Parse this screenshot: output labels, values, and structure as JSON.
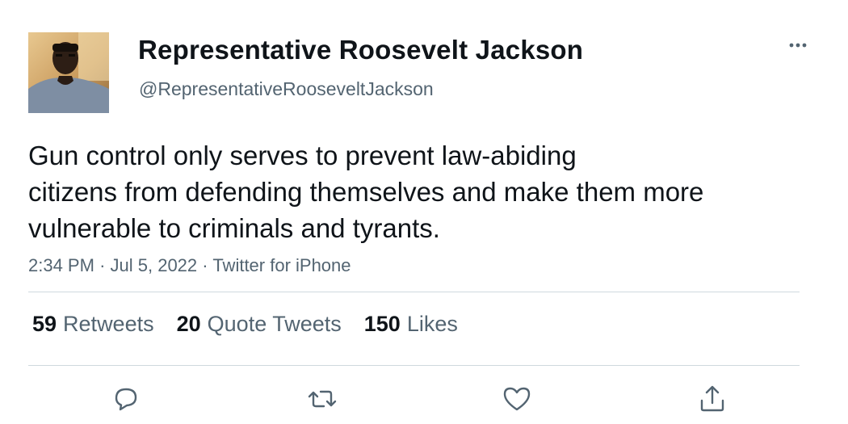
{
  "author": {
    "display_name": "Representative Roosevelt Jackson",
    "handle": "@RepresentativeRooseveltJackson"
  },
  "more_icon": "more-horizontal-icon",
  "tweet": {
    "lines": [
      "Gun control only serves to prevent law-abiding",
      "citizens from defending themselves and make them more",
      "vulnerable to criminals and tyrants."
    ]
  },
  "meta": {
    "time": "2:34 PM",
    "separator": "·",
    "date": "Jul 5, 2022",
    "source": "Twitter for iPhone"
  },
  "stats": [
    {
      "count": "59",
      "label": "Retweets"
    },
    {
      "count": "20",
      "label": "Quote Tweets"
    },
    {
      "count": "150",
      "label": "Likes"
    }
  ],
  "actions": [
    "reply-icon",
    "retweet-icon",
    "like-icon",
    "share-icon"
  ],
  "colors": {
    "text": "#0f1419",
    "secondary": "#536471",
    "divider": "#cfd9de"
  }
}
